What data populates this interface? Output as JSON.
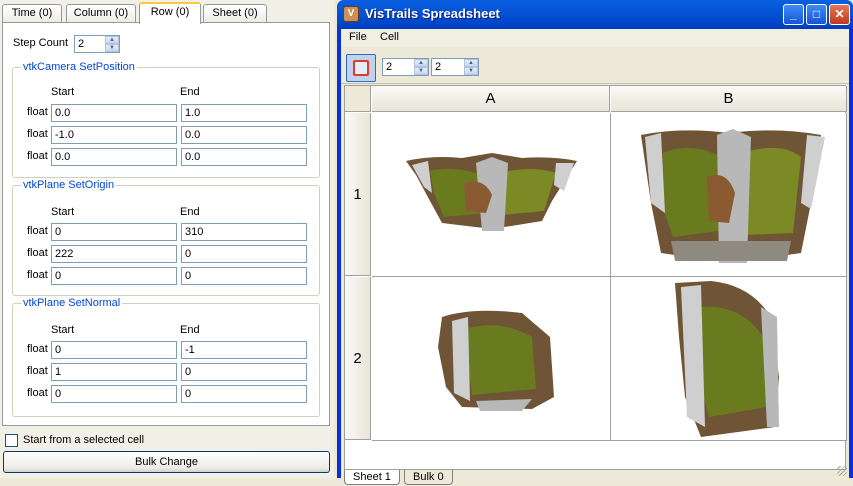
{
  "left_panel": {
    "tabs": [
      {
        "label": "Time (0)"
      },
      {
        "label": "Column (0)"
      },
      {
        "label": "Row (0)"
      },
      {
        "label": "Sheet (0)"
      }
    ],
    "step_count_label": "Step Count",
    "step_count_value": "2",
    "groups": [
      {
        "title": "vtkCamera SetPosition",
        "start_header": "Start",
        "end_header": "End",
        "rows": [
          {
            "type": "float",
            "start": "0.0",
            "end": "1.0"
          },
          {
            "type": "float",
            "start": "-1.0",
            "end": "0.0"
          },
          {
            "type": "float",
            "start": "0.0",
            "end": "0.0"
          }
        ]
      },
      {
        "title": "vtkPlane SetOrigin",
        "start_header": "Start",
        "end_header": "End",
        "rows": [
          {
            "type": "float",
            "start": "0",
            "end": "310"
          },
          {
            "type": "float",
            "start": "222",
            "end": "0"
          },
          {
            "type": "float",
            "start": "0",
            "end": "0"
          }
        ]
      },
      {
        "title": "vtkPlane SetNormal",
        "start_header": "Start",
        "end_header": "End",
        "rows": [
          {
            "type": "float",
            "start": "0",
            "end": "-1"
          },
          {
            "type": "float",
            "start": "1",
            "end": "0"
          },
          {
            "type": "float",
            "start": "0",
            "end": "0"
          }
        ]
      }
    ],
    "start_from_selected_label": "Start from a selected cell",
    "bulk_change_label": "Bulk Change"
  },
  "window": {
    "title": "VisTrails Spreadsheet",
    "menus": [
      "File",
      "Cell"
    ],
    "toolbar": {
      "rows_value": "2",
      "cols_value": "2"
    },
    "columns": [
      "A",
      "B"
    ],
    "rows": [
      "1",
      "2"
    ],
    "sheet_tabs": [
      "Sheet 1",
      "Bulk 0"
    ],
    "colors": {
      "titlebar": "#0653d5",
      "tissue": "#6a7a1e",
      "bone": "#b8b8b8"
    }
  }
}
